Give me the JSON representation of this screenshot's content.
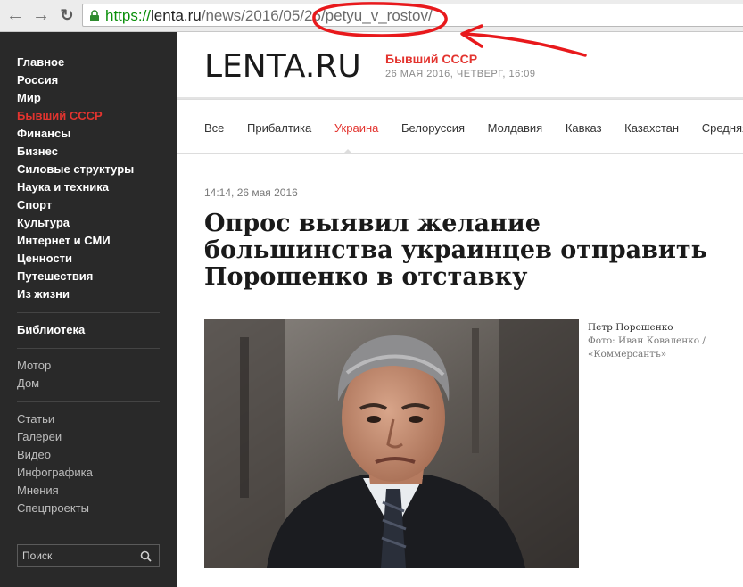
{
  "browser": {
    "url_scheme": "https://",
    "url_host": "lenta.ru",
    "url_path": "/news/2016/05/26/petyu_v_rostov/"
  },
  "sidebar": {
    "main": [
      {
        "label": "Главное"
      },
      {
        "label": "Россия"
      },
      {
        "label": "Мир"
      },
      {
        "label": "Бывший СССР",
        "active": true
      },
      {
        "label": "Финансы"
      },
      {
        "label": "Бизнес"
      },
      {
        "label": "Силовые структуры"
      },
      {
        "label": "Наука и техника"
      },
      {
        "label": "Спорт"
      },
      {
        "label": "Культура"
      },
      {
        "label": "Интернет и СМИ"
      },
      {
        "label": "Ценности"
      },
      {
        "label": "Путешествия"
      },
      {
        "label": "Из жизни"
      }
    ],
    "library": "Библиотека",
    "projects": [
      {
        "label": "Мотор"
      },
      {
        "label": "Дом"
      }
    ],
    "formats": [
      {
        "label": "Статьи"
      },
      {
        "label": "Галереи"
      },
      {
        "label": "Видео"
      },
      {
        "label": "Инфографика"
      },
      {
        "label": "Мнения"
      },
      {
        "label": "Спецпроекты"
      }
    ],
    "search_label": "Поиск"
  },
  "header": {
    "logo": "LENTA.RU",
    "section": "Бывший СССР",
    "date": "26 МАЯ 2016, ЧЕТВЕРГ, 16:09"
  },
  "subnav": {
    "items": [
      {
        "label": "Все"
      },
      {
        "label": "Прибалтика"
      },
      {
        "label": "Украина",
        "active": true
      },
      {
        "label": "Белоруссия"
      },
      {
        "label": "Молдавия"
      },
      {
        "label": "Кавказ"
      },
      {
        "label": "Казахстан"
      },
      {
        "label": "Средняя Азия"
      }
    ]
  },
  "article": {
    "timestamp": "14:14, 26 мая 2016",
    "headline": "Опрос выявил желание большинства украинцев отправить Порошенко в отставку",
    "photo_caption": "Петр Порошенко",
    "photo_credit_line1": "Фото: Иван Коваленко /",
    "photo_credit_line2": "«Коммерсантъ»"
  },
  "colors": {
    "accent": "#e3342f",
    "sidebar_bg": "#292929",
    "annotation": "#e8191c",
    "url_secure": "#0a8f0a"
  }
}
